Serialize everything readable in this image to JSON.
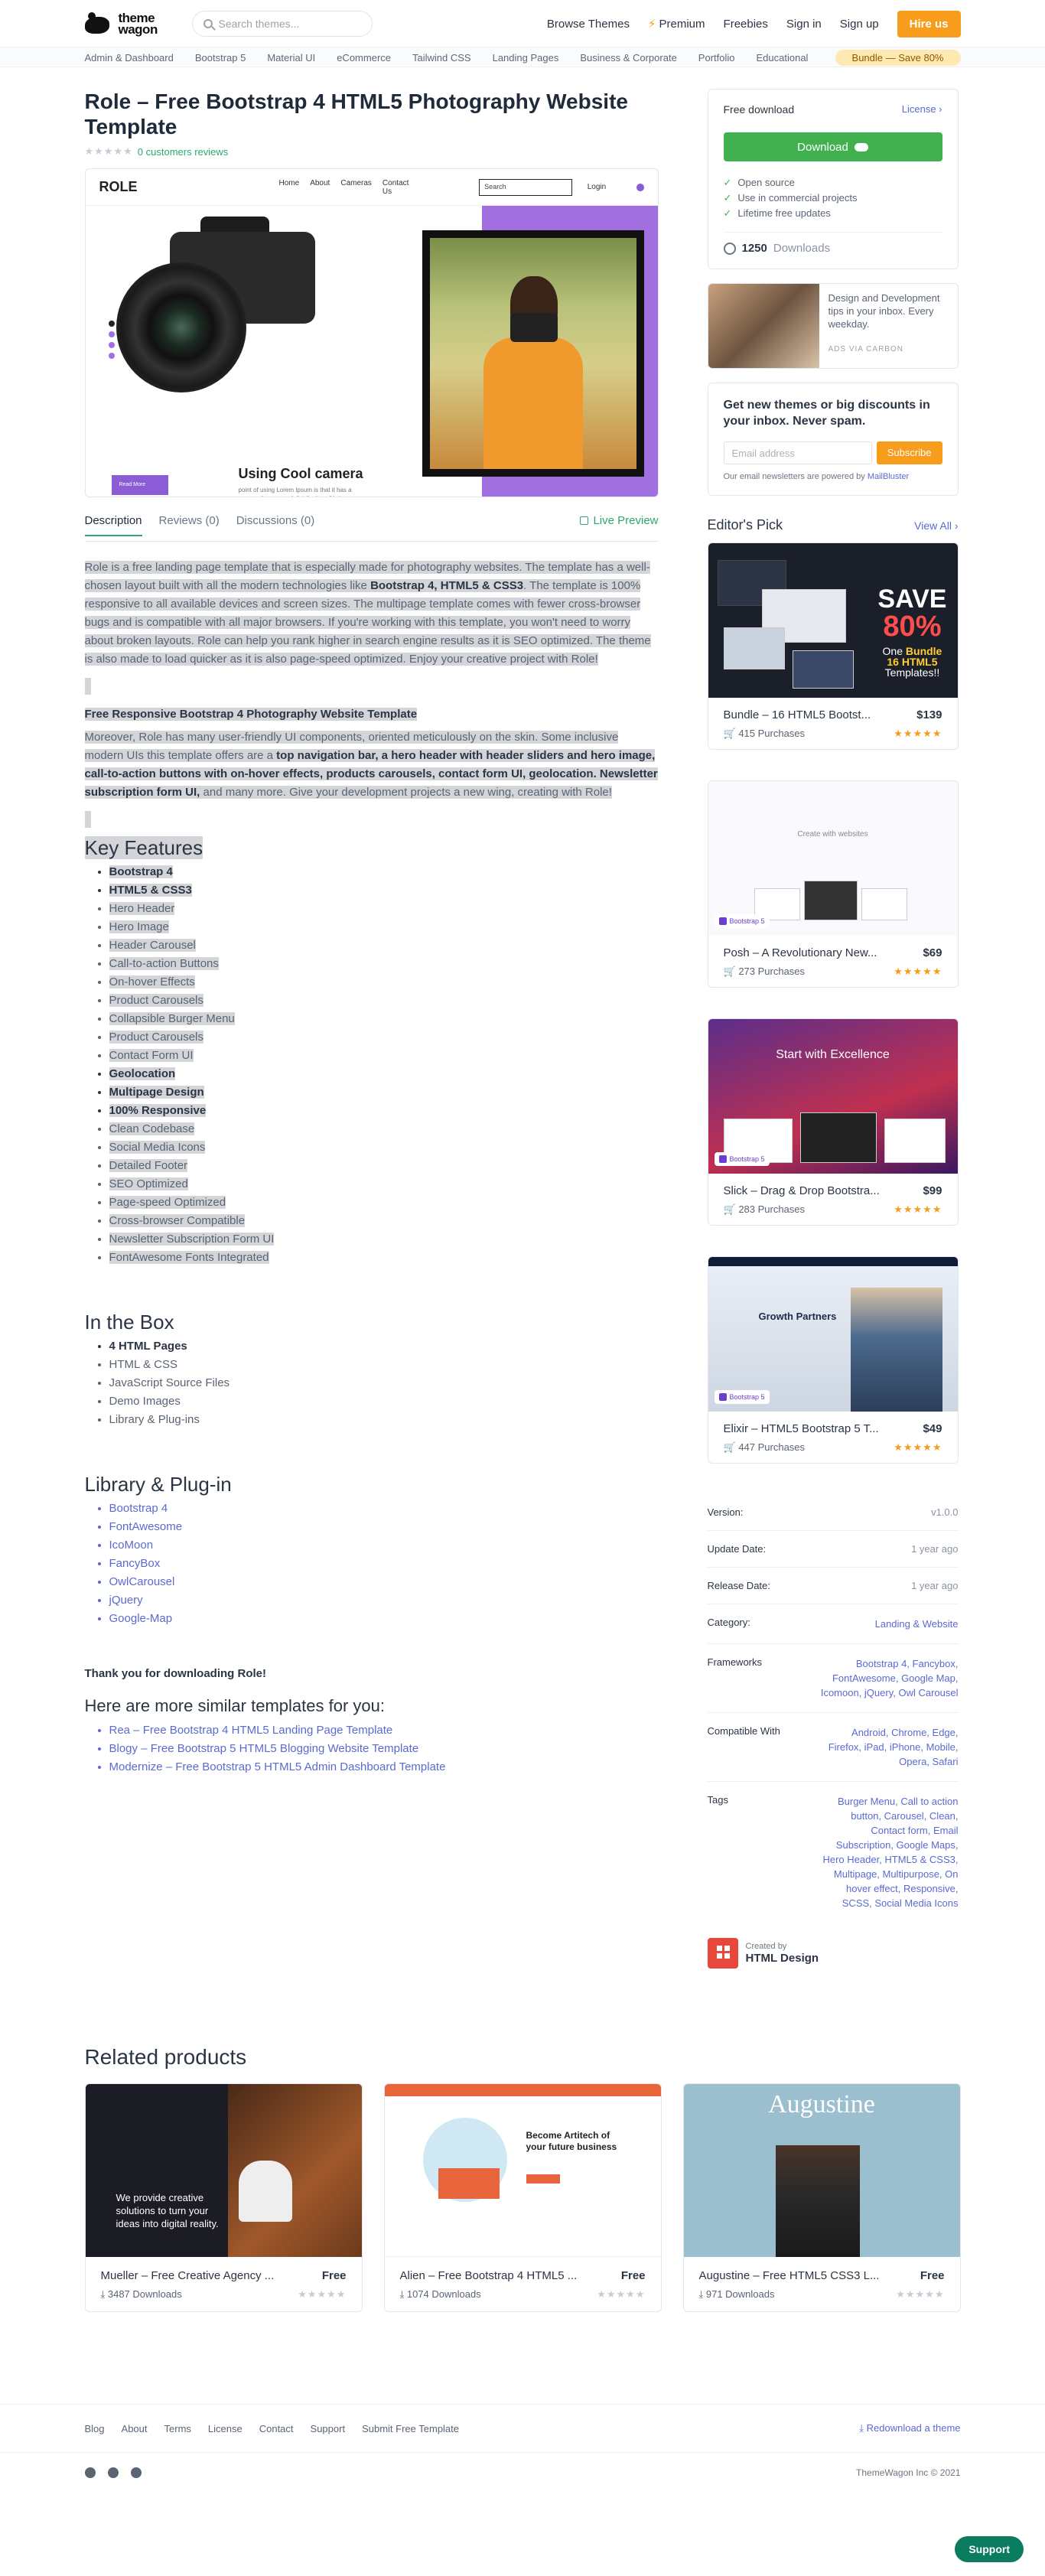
{
  "header": {
    "logo_line1": "theme",
    "logo_line2": "wagon",
    "search_placeholder": "Search themes...",
    "nav": [
      "Browse Themes",
      "Premium",
      "Freebies",
      "Sign in",
      "Sign up"
    ],
    "hire": "Hire us"
  },
  "categories": [
    "Admin & Dashboard",
    "Bootstrap 5",
    "Material UI",
    "eCommerce",
    "Tailwind CSS",
    "Landing Pages",
    "Business & Corporate",
    "Portfolio",
    "Educational"
  ],
  "bundle_pill": "Bundle — Save 80%",
  "product": {
    "title": "Role – Free Bootstrap 4 HTML5 Photography Website Template",
    "reviews": "0 customers reviews"
  },
  "preview": {
    "logo": "ROLE",
    "menu": [
      "Home",
      "About",
      "Cameras",
      "Contact Us"
    ],
    "search": "Search",
    "login": "Login",
    "headline": "Using Cool camera",
    "sub": "point of using Lorem Ipsum is that it has a more-or-less normal distribution of letters,",
    "btn": "Read More"
  },
  "tabs": [
    "Description",
    "Reviews (0)",
    "Discussions (0)"
  ],
  "live_preview": "Live Preview",
  "desc": {
    "p1a": "Role is a free landing page template that is especially made for photography websites. The template has a well-chosen layout built with all the modern technologies like ",
    "p1b": "Bootstrap 4, HTML5 & CSS3",
    "p1c": ". The template is 100% responsive to all available devices and screen sizes. The multipage template comes with fewer cross-browser bugs and is compatible with all major browsers. If you're working with this template, you won't need to worry about broken layouts. Role can help you rank higher in search engine results as it is SEO optimized. The theme is also made to load quicker as it is also page-speed optimized. Enjoy your creative project with Role!",
    "h": "Free Responsive Bootstrap 4 Photography Website Template",
    "p2a": "Moreover, Role has many user-friendly UI components, oriented meticulously on the skin. Some inclusive modern UIs this template offers are a ",
    "p2b": "top navigation bar, a hero header with header sliders and hero image, call-to-action buttons with on-hover effects, products carousels, contact form UI, geolocation. Newsletter subscription form UI,",
    "p2c": " and many more. Give your development projects a new wing, creating with Role!"
  },
  "key_features_title": "Key Features",
  "key_features": [
    "Bootstrap 4",
    "HTML5 & CSS3",
    "Hero Header",
    "Hero Image",
    "Header Carousel",
    "Call-to-action Buttons",
    "On-hover Effects",
    "Product Carousels",
    "Collapsible Burger Menu",
    "Product Carousels",
    "Contact Form UI",
    "Geolocation",
    "Multipage Design",
    "100% Responsive",
    "Clean Codebase",
    "Social Media Icons",
    "Detailed Footer",
    "SEO Optimized",
    "Page-speed Optimized",
    "Cross-browser Compatible",
    "Newsletter Subscription Form UI",
    "FontAwesome Fonts Integrated"
  ],
  "box_title": "In the Box",
  "box": [
    "4 HTML Pages",
    "HTML & CSS",
    "JavaScript Source Files",
    "Demo Images",
    "Library & Plug-ins"
  ],
  "lib_title": "Library & Plug-in",
  "libs": [
    "Bootstrap 4",
    "FontAwesome",
    "IcoMoon",
    "FancyBox",
    "OwlCarousel",
    "jQuery",
    "Google-Map"
  ],
  "thanks": "Thank you for downloading Role!",
  "more_title": "Here are more similar templates for you:",
  "more": [
    "Rea – Free Bootstrap 4 HTML5 Landing Page Template",
    "Blogy – Free Bootstrap 5 HTML5 Blogging Website Template",
    "Modernize – Free Bootstrap 5 HTML5 Admin Dashboard Template"
  ],
  "download": {
    "label": "Free download",
    "license": "License",
    "button": "Download",
    "checks": [
      "Open source",
      "Use in commercial projects",
      "Lifetime free updates"
    ],
    "count": "1250",
    "count_label": "Downloads"
  },
  "ad": {
    "text": "Design and Development tips in your inbox. Every weekday.",
    "by": "ADS VIA CARBON"
  },
  "newsletter": {
    "title": "Get new themes or big discounts in your inbox. Never spam.",
    "placeholder": "Email address",
    "button": "Subscribe",
    "note": "Our email newsletters are powered by ",
    "note_link": "MailBluster"
  },
  "editors_pick": {
    "title": "Editor's Pick",
    "view_all": "View All",
    "items": [
      {
        "name": "Bundle – 16 HTML5 Bootst...",
        "price": "$139",
        "purchases": "415 Purchases"
      },
      {
        "name": "Posh – A Revolutionary New...",
        "price": "$69",
        "purchases": "273 Purchases"
      },
      {
        "name": "Slick – Drag & Drop Bootstra...",
        "price": "$99",
        "purchases": "283 Purchases"
      },
      {
        "name": "Elixir – HTML5 Bootstrap 5 T...",
        "price": "$49",
        "purchases": "447 Purchases"
      }
    ],
    "bundle_save": "SAVE",
    "bundle_pct": "80%",
    "bundle_one": "One",
    "bundle_word": "Bundle",
    "bundle_n": "16 HTML5",
    "bundle_t": "Templates!!",
    "slick_title": "Start with Excellence",
    "elixir_title": "Growth Partners",
    "badge": "Bootstrap 5",
    "posh_title": "Create with websites"
  },
  "specs": [
    {
      "k": "Version:",
      "v": "v1.0.0",
      "link": false
    },
    {
      "k": "Update Date:",
      "v": "1 year ago",
      "link": false
    },
    {
      "k": "Release Date:",
      "v": "1 year ago",
      "link": false
    },
    {
      "k": "Category:",
      "v": "Landing & Website",
      "link": true
    },
    {
      "k": "Frameworks",
      "v": "Bootstrap 4, Fancybox, FontAwesome, Google Map, Icomoon, jQuery, Owl Carousel",
      "link": true
    },
    {
      "k": "Compatible With",
      "v": "Android, Chrome, Edge, Firefox, iPad, iPhone, Mobile, Opera, Safari",
      "link": true
    },
    {
      "k": "Tags",
      "v": "Burger Menu, Call to action button, Carousel, Clean, Contact form, Email Subscription, Google Maps, Hero Header, HTML5 & CSS3, Multipage, Multipurpose, On hover effect, Responsive, SCSS, Social Media Icons",
      "link": true
    }
  ],
  "creator": {
    "by": "Created by",
    "name": "HTML Design"
  },
  "related": {
    "title": "Related products",
    "items": [
      {
        "name": "Mueller – Free Creative Agency ...",
        "price": "Free",
        "downloads": "3487 Downloads",
        "img_text": "We provide creative solutions to turn your ideas into digital reality."
      },
      {
        "name": "Alien – Free Bootstrap 4 HTML5 ...",
        "price": "Free",
        "downloads": "1074 Downloads",
        "img_text": "Become Artitech of your future business"
      },
      {
        "name": "Augustine – Free HTML5 CSS3 L...",
        "price": "Free",
        "downloads": "971 Downloads",
        "img_text": "Augustine"
      }
    ]
  },
  "footer": {
    "links": [
      "Blog",
      "About",
      "Terms",
      "License",
      "Contact",
      "Support",
      "Submit Free Template"
    ],
    "redownload": "Redownload a theme",
    "copyright": "ThemeWagon Inc © 2021",
    "support": "Support"
  },
  "colors": {
    "accent": "#f89c1c",
    "green": "#41b04e",
    "link": "#5b6ad0",
    "highlight": "#d3d5d8"
  }
}
